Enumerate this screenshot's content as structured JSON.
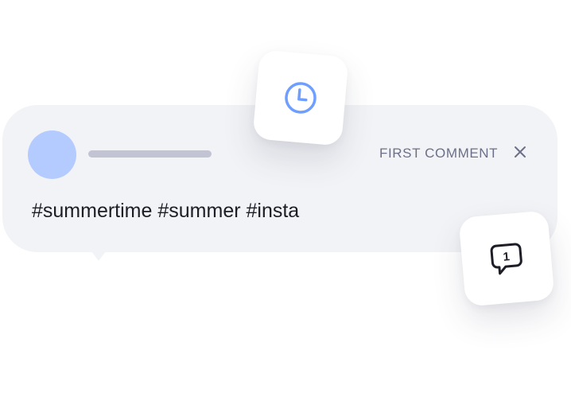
{
  "comment_card": {
    "label": "FIRST COMMENT",
    "text": "#summertime #summer #insta",
    "close_icon": "close-icon"
  },
  "badges": {
    "schedule_icon": "clock-icon",
    "comment_icon": "speech-bubble-icon",
    "comment_count": "1"
  },
  "colors": {
    "card_background": "#f2f3f6",
    "avatar": "#b3cbff",
    "accent_blue": "#6e9eff",
    "label_text": "#6d6f88",
    "body_text": "#1c1d26"
  }
}
